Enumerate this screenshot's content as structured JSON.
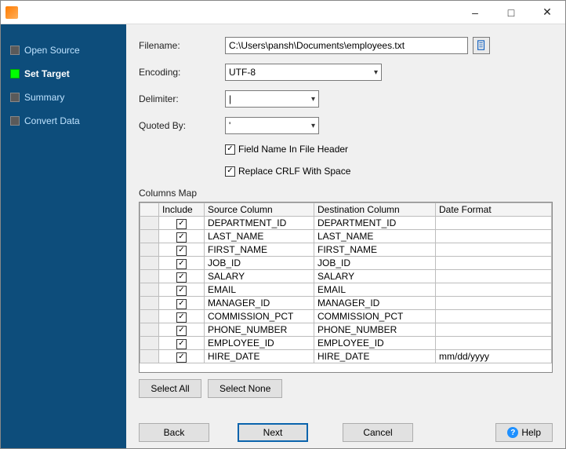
{
  "titlebar": {
    "app": ""
  },
  "sidebar": {
    "items": [
      {
        "label": "Open Source",
        "active": false
      },
      {
        "label": "Set Target",
        "active": true
      },
      {
        "label": "Summary",
        "active": false
      },
      {
        "label": "Convert Data",
        "active": false
      }
    ]
  },
  "form": {
    "filename_label": "Filename:",
    "filename_value": "C:\\Users\\pansh\\Documents\\employees.txt",
    "encoding_label": "Encoding:",
    "encoding_value": "UTF-8",
    "delimiter_label": "Delimiter:",
    "delimiter_value": "|",
    "quoted_label": "Quoted By:",
    "quoted_value": "'",
    "chk_header_label": "Field Name In File Header",
    "chk_header_checked": true,
    "chk_crlf_label": "Replace CRLF With Space",
    "chk_crlf_checked": true
  },
  "columns_map": {
    "title": "Columns Map",
    "headers": {
      "include": "Include",
      "source": "Source Column",
      "dest": "Destination Column",
      "date": "Date Format"
    },
    "rows": [
      {
        "include": true,
        "source": "DEPARTMENT_ID",
        "dest": "DEPARTMENT_ID",
        "date": ""
      },
      {
        "include": true,
        "source": "LAST_NAME",
        "dest": "LAST_NAME",
        "date": ""
      },
      {
        "include": true,
        "source": "FIRST_NAME",
        "dest": "FIRST_NAME",
        "date": ""
      },
      {
        "include": true,
        "source": "JOB_ID",
        "dest": "JOB_ID",
        "date": ""
      },
      {
        "include": true,
        "source": "SALARY",
        "dest": "SALARY",
        "date": ""
      },
      {
        "include": true,
        "source": "EMAIL",
        "dest": "EMAIL",
        "date": ""
      },
      {
        "include": true,
        "source": "MANAGER_ID",
        "dest": "MANAGER_ID",
        "date": ""
      },
      {
        "include": true,
        "source": "COMMISSION_PCT",
        "dest": "COMMISSION_PCT",
        "date": ""
      },
      {
        "include": true,
        "source": "PHONE_NUMBER",
        "dest": "PHONE_NUMBER",
        "date": ""
      },
      {
        "include": true,
        "source": "EMPLOYEE_ID",
        "dest": "EMPLOYEE_ID",
        "date": ""
      },
      {
        "include": true,
        "source": "HIRE_DATE",
        "dest": "HIRE_DATE",
        "date": "mm/dd/yyyy"
      }
    ]
  },
  "buttons": {
    "select_all": "Select All",
    "select_none": "Select None",
    "back": "Back",
    "next": "Next",
    "cancel": "Cancel",
    "help": "Help"
  }
}
